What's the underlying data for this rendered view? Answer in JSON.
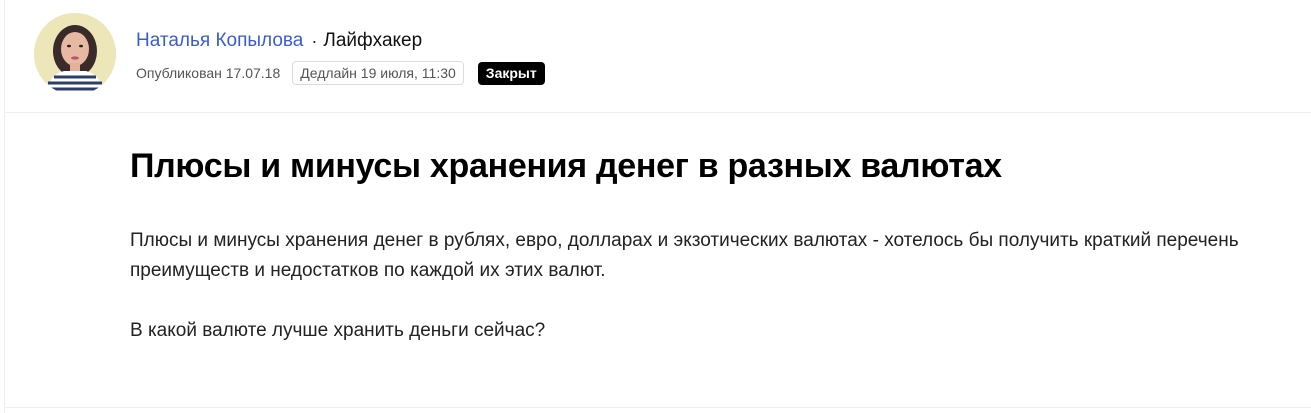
{
  "author": {
    "name": "Наталья Копылова",
    "separator": "·",
    "publication": "Лайфхакер",
    "avatar_icon": "user-avatar-photo"
  },
  "meta": {
    "published": "Опубликован 17.07.18",
    "deadline": "Дедлайн 19 июля, 11:30",
    "status": "Закрыт"
  },
  "question": {
    "title": "Плюсы и минусы хранения денег в разных валютах",
    "paragraphs": [
      "Плюсы и минусы хранения денег в рублях, евро, долларах и экзотических валютах - хотелось бы получить краткий перечень преимуществ и недостатков по каждой их этих валют.",
      "В какой валюте лучше хранить деньги сейчас?"
    ]
  },
  "colors": {
    "author_link": "#3a5bd4",
    "status_badge_bg": "#000000",
    "status_badge_text": "#ffffff"
  }
}
